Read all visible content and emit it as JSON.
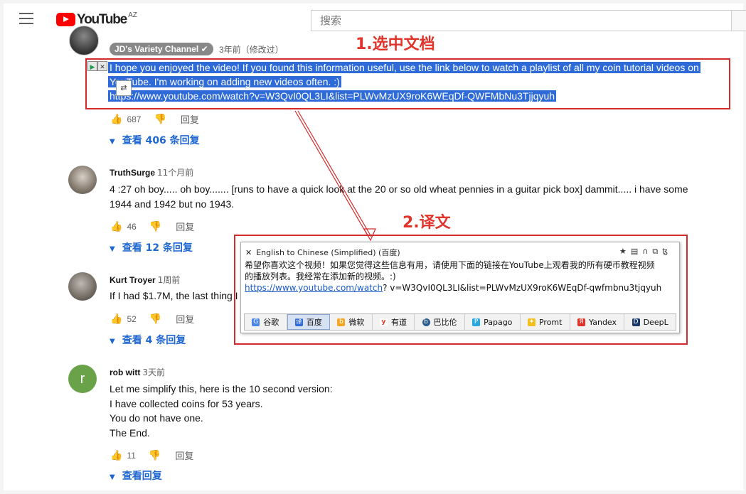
{
  "header": {
    "logo_text": "YouTube",
    "logo_country": "AZ",
    "search_placeholder": "搜索"
  },
  "annotations": {
    "step1": "1.选中文档",
    "step2": "2.译文"
  },
  "comments": [
    {
      "author": "JD's Variety Channel",
      "verified": true,
      "time": "3年前（修改过）",
      "lines": [
        "I hope you enjoyed the video! If you found this information useful, use the link below to watch a playlist of all my coin tutorial videos on",
        "YouTube. I'm working on adding new videos often. :)",
        "https://www.youtube.com/watch?v=W3QvI0QL3LI&list=PLWvMzUX9roK6WEqDf-QWFMbNu3Tjjqyuh"
      ],
      "likes": "687",
      "reply_label": "回复",
      "view_replies": "查看 406 条回复"
    },
    {
      "author": "TruthSurge",
      "time": "11个月前",
      "lines": [
        "4 :27  oh boy..... oh boy.......   [runs to have a quick look at the 20 or so old wheat pennies in a guitar pick box]   dammit.....   i have some",
        "1944 and 1942 but no 1943."
      ],
      "likes": "46",
      "reply_label": "回复",
      "view_replies": "查看 12 条回复"
    },
    {
      "author": "Kurt Troyer",
      "time": "1周前",
      "lines": [
        "If I had $1.7M, the last thing I"
      ],
      "likes": "52",
      "reply_label": "回复",
      "view_replies": "查看 4 条回复"
    },
    {
      "author": "rob witt",
      "avatar_letter": "r",
      "time": "3天前",
      "lines": [
        "Let me simplify this, here is the 10 second version:",
        "I have collected coins for 53 years.",
        "You do not have one.",
        "The End."
      ],
      "likes": "11",
      "reply_label": "回复",
      "view_replies": "查看回复"
    }
  ],
  "translator": {
    "title": "English to Chinese (Simplified) (百度)",
    "text_line1": "希望你喜欢这个视频！如果您觉得这些信息有用，请使用下面的链接在YouTube上观看我的所有硬币教程视频",
    "text_line2": "的播放列表。我经常在添加新的视频。:)",
    "link": "https://www.youtube.com/watch",
    "link_rest": "? v=W3QvI0QL3LI&list=PLWvMzUX9roK6WEqDf-qwfmbnu3tjqyuh",
    "engines": [
      "谷歌",
      "百度",
      "微软",
      "有道",
      "巴比伦",
      "Papago",
      "Promt",
      "Yandex",
      "DeepL"
    ],
    "active_engine": "百度"
  },
  "colors": {
    "annotation_red": "#e0342b",
    "selection_blue": "#2f6bd8",
    "link_blue": "#1e66d0",
    "youtube_red": "#ff0000"
  }
}
